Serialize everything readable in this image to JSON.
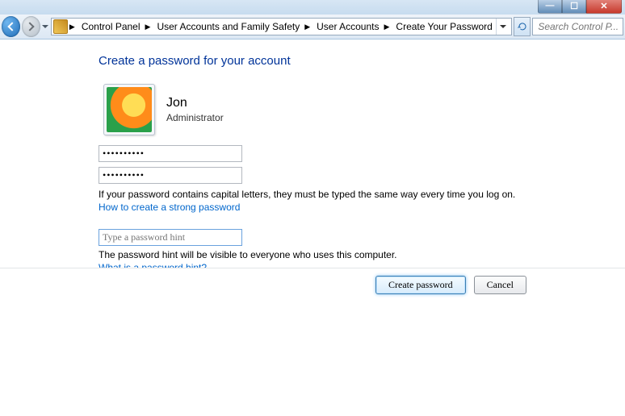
{
  "window_controls": {
    "min": "—",
    "max": "☐",
    "close": "✕"
  },
  "breadcrumb": {
    "items": [
      "Control Panel",
      "User Accounts and Family Safety",
      "User Accounts",
      "Create Your Password"
    ]
  },
  "search": {
    "placeholder": "Search Control P..."
  },
  "page": {
    "title": "Create a password for your account",
    "user_name": "Jon",
    "user_role": "Administrator",
    "password1": "••••••••••",
    "password2": "••••••••••",
    "caps_warning": "If your password contains capital letters, they must be typed the same way every time you log on.",
    "strong_link": "How to create a strong password",
    "hint_placeholder": "Type a password hint",
    "hint_warning": "The password hint will be visible to everyone who uses this computer.",
    "hint_link": "What is a password hint?"
  },
  "buttons": {
    "create": "Create password",
    "cancel": "Cancel"
  }
}
